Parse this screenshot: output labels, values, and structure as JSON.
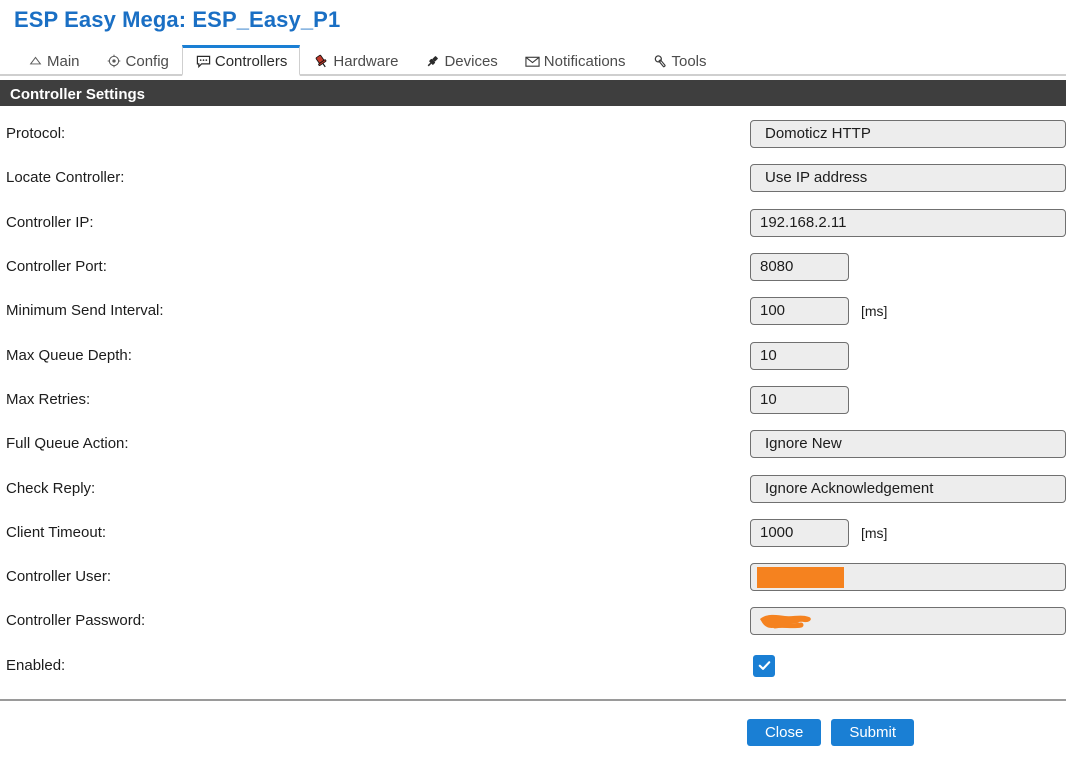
{
  "header": {
    "title": "ESP Easy Mega: ESP_Easy_P1",
    "title_color": "#1a6fc4"
  },
  "tabs": [
    {
      "label": "Main",
      "icon": "home-icon",
      "active": false
    },
    {
      "label": "Config",
      "icon": "gear-icon",
      "active": false
    },
    {
      "label": "Controllers",
      "icon": "speech-bubble-icon",
      "active": true
    },
    {
      "label": "Hardware",
      "icon": "pushpin-icon",
      "active": false
    },
    {
      "label": "Devices",
      "icon": "plug-icon",
      "active": false
    },
    {
      "label": "Notifications",
      "icon": "envelope-icon",
      "active": false
    },
    {
      "label": "Tools",
      "icon": "wrench-icon",
      "active": false
    }
  ],
  "section": {
    "title": "Controller Settings",
    "bar_color": "#3e3e3e"
  },
  "fields": {
    "protocol": {
      "label": "Protocol:",
      "value": "Domoticz HTTP"
    },
    "locate": {
      "label": "Locate Controller:",
      "value": "Use IP address"
    },
    "controller_ip": {
      "label": "Controller IP:",
      "value": "192.168.2.11"
    },
    "controller_port": {
      "label": "Controller Port:",
      "value": "8080"
    },
    "min_send": {
      "label": "Minimum Send Interval:",
      "value": "100",
      "unit": "[ms]"
    },
    "max_queue": {
      "label": "Max Queue Depth:",
      "value": "10"
    },
    "max_retries": {
      "label": "Max Retries:",
      "value": "10"
    },
    "full_queue": {
      "label": "Full Queue Action:",
      "value": "Ignore New"
    },
    "check_reply": {
      "label": "Check Reply:",
      "value": "Ignore Acknowledgement"
    },
    "client_timeout": {
      "label": "Client Timeout:",
      "value": "1000",
      "unit": "[ms]"
    },
    "user": {
      "label": "Controller User:",
      "value": "",
      "redacted": true,
      "redaction_color": "#F5821F"
    },
    "password": {
      "label": "Controller Password:",
      "value": "",
      "redacted": true,
      "redaction_color": "#F5821F"
    },
    "enabled": {
      "label": "Enabled:",
      "checked": true,
      "check_color": "#1a7fd4"
    }
  },
  "footer": {
    "close_label": "Close",
    "submit_label": "Submit",
    "button_color": "#1a7fd4"
  }
}
